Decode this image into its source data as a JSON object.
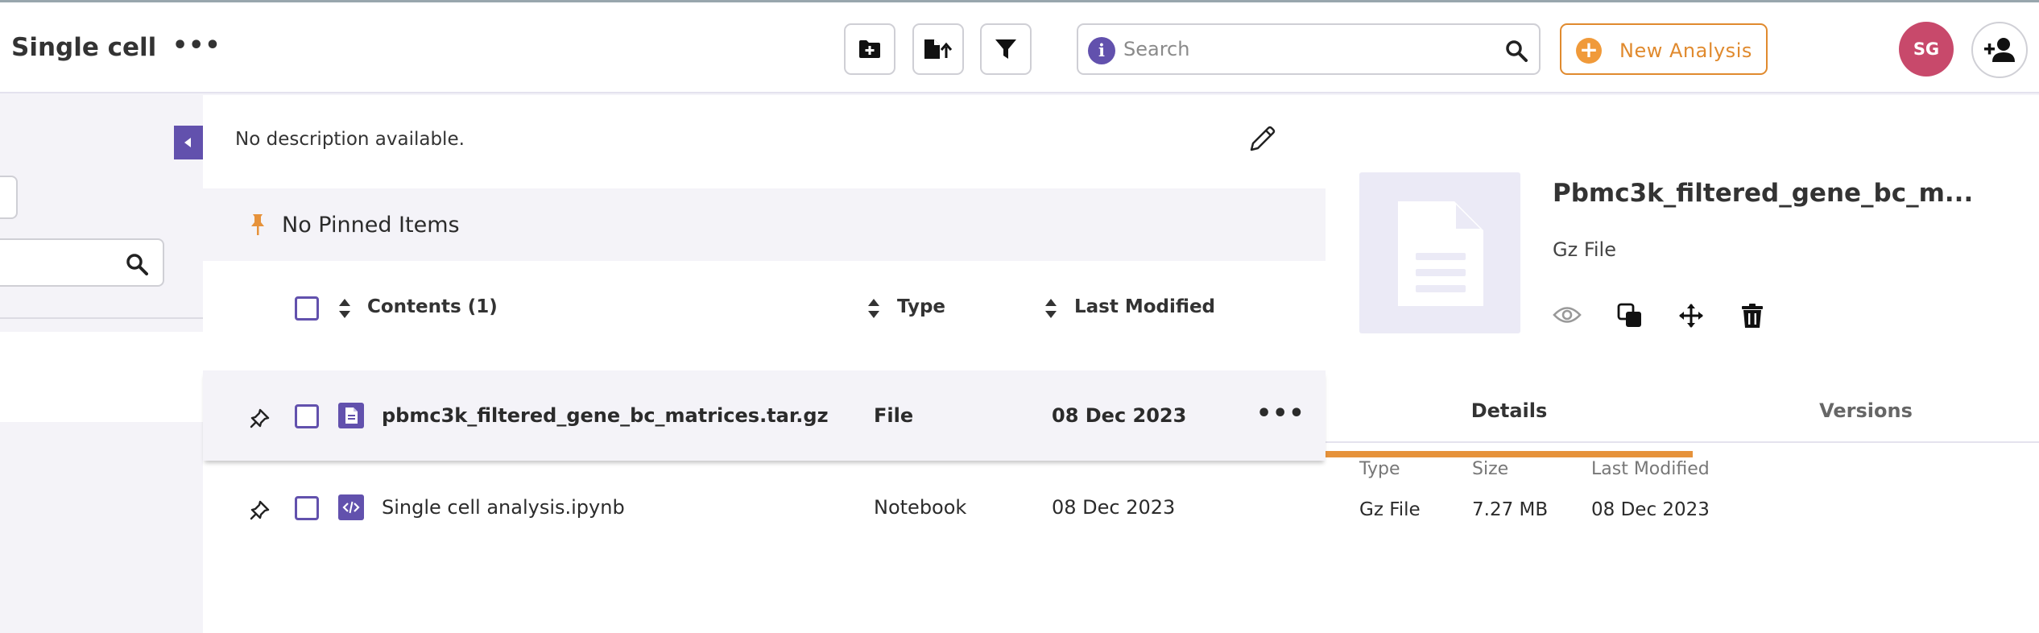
{
  "header": {
    "title": "Single cell",
    "search_placeholder": "Search",
    "new_analysis_label": "New Analysis",
    "avatar_initials": "SG"
  },
  "description": "No description available.",
  "pinned": {
    "label": "No Pinned Items"
  },
  "table": {
    "columns": {
      "contents": "Contents (1)",
      "type": "Type",
      "modified": "Last Modified"
    },
    "rows": [
      {
        "name": "pbmc3k_filtered_gene_bc_matrices.tar.gz",
        "type": "File",
        "modified": "08 Dec 2023",
        "icon": "file-icon"
      },
      {
        "name": "Single cell analysis.ipynb",
        "type": "Notebook",
        "modified": "08 Dec 2023",
        "icon": "code-icon"
      }
    ]
  },
  "details": {
    "name": "Pbmc3k_filtered_gene_bc_m...",
    "subtitle": "Gz File",
    "tabs": [
      "Details",
      "Versions"
    ],
    "fields": [
      {
        "label": "Type",
        "value": "Gz File"
      },
      {
        "label": "Size",
        "value": "7.27 MB"
      },
      {
        "label": "Last Modified",
        "value": "08 Dec 2023"
      }
    ]
  },
  "colors": {
    "accent": "#6251ad",
    "orange": "#e08a2e",
    "avatar": "#c8496b"
  }
}
